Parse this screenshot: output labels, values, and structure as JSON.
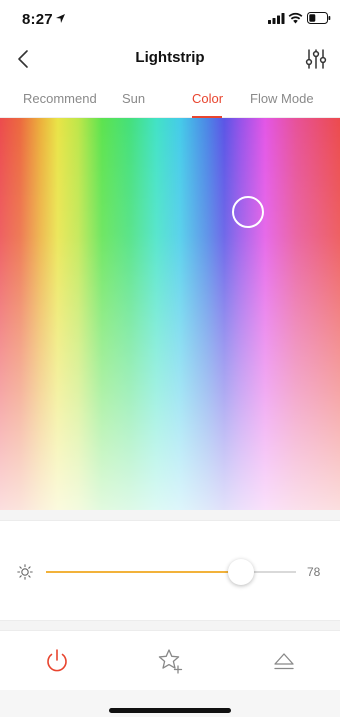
{
  "status_bar": {
    "time": "8:27",
    "icons": [
      "location-arrow-icon",
      "signal-bars-icon",
      "wifi-icon",
      "battery-icon"
    ]
  },
  "header": {
    "title": "Lightstrip",
    "back_icon": "chevron-left-icon",
    "settings_icon": "sliders-icon"
  },
  "tabs": [
    {
      "label": "Recommend",
      "active": false
    },
    {
      "label": "Sun",
      "active": false
    },
    {
      "label": "Color",
      "active": true
    },
    {
      "label": "Flow Mode",
      "active": false
    }
  ],
  "colors": {
    "accent": "#e8452f",
    "slider_fill": "#f2b23a"
  },
  "brightness": {
    "icon": "sun-icon",
    "value": 78,
    "value_label": "78"
  },
  "bottom_bar": {
    "items": [
      {
        "icon": "power-icon",
        "color": "#e8452f"
      },
      {
        "icon": "star-add-icon",
        "color": "#888888"
      },
      {
        "icon": "eject-icon",
        "color": "#888888"
      }
    ]
  }
}
